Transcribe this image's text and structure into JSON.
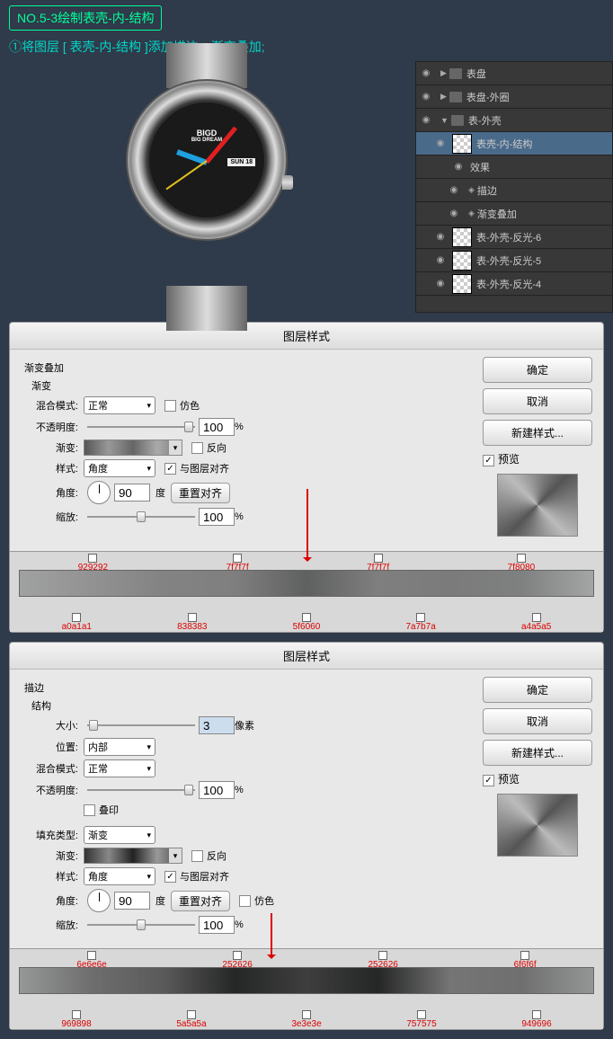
{
  "header": "NO.5-3绘制表壳-内-结构",
  "subtitle": "①将图层 [ 表壳-内-结构 ]添加描边、渐变叠加;",
  "watch": {
    "brand": "BIGD",
    "brand_sub": "BIG DREAM",
    "date": "SUN 18"
  },
  "layers": {
    "items": [
      {
        "label": "表盘",
        "type": "folder"
      },
      {
        "label": "表盘-外圈",
        "type": "folder"
      },
      {
        "label": "表-外壳",
        "type": "folder",
        "open": true
      },
      {
        "label": "表壳-内-结构",
        "type": "layer",
        "hl": true
      },
      {
        "label": "效果",
        "type": "fx"
      },
      {
        "label": "描边",
        "type": "fx"
      },
      {
        "label": "渐变叠加",
        "type": "fx"
      },
      {
        "label": "表-外壳-反光-6",
        "type": "layer"
      },
      {
        "label": "表-外壳-反光-5",
        "type": "layer"
      },
      {
        "label": "表-外壳-反光-4",
        "type": "layer"
      }
    ]
  },
  "dialog1": {
    "title": "图层样式",
    "section": "渐变叠加",
    "subsection": "渐变",
    "blend_label": "混合模式:",
    "blend_val": "正常",
    "dither_label": "仿色",
    "opacity_label": "不透明度:",
    "opacity_val": "100",
    "opacity_unit": "%",
    "gradient_label": "渐变:",
    "reverse_label": "反向",
    "style_label": "样式:",
    "style_val": "角度",
    "align_label": "与图层对齐",
    "angle_label": "角度:",
    "angle_val": "90",
    "angle_unit": "度",
    "reset_label": "重置对齐",
    "scale_label": "缩放:",
    "scale_val": "100",
    "scale_unit": "%",
    "ok": "确定",
    "cancel": "取消",
    "new_style": "新建样式...",
    "preview": "预览",
    "stops_top": [
      "929292",
      "7f7f7f",
      "7f7f7f",
      "7f8080"
    ],
    "stops_bot": [
      "a0a1a1",
      "838383",
      "5f6060",
      "7a7b7a",
      "a4a5a5"
    ]
  },
  "dialog2": {
    "title": "图层样式",
    "section": "描边",
    "subsection": "结构",
    "size_label": "大小:",
    "size_val": "3",
    "size_unit": "像素",
    "pos_label": "位置:",
    "pos_val": "内部",
    "blend_label": "混合模式:",
    "blend_val": "正常",
    "opacity_label": "不透明度:",
    "opacity_val": "100",
    "opacity_unit": "%",
    "overprint_label": "叠印",
    "fill_label": "填充类型:",
    "fill_val": "渐变",
    "gradient_label": "渐变:",
    "reverse_label": "反向",
    "style_label": "样式:",
    "style_val": "角度",
    "align_label": "与图层对齐",
    "angle_label": "角度:",
    "angle_val": "90",
    "angle_unit": "度",
    "reset_label": "重置对齐",
    "dither_label": "仿色",
    "scale_label": "缩放:",
    "scale_val": "100",
    "scale_unit": "%",
    "ok": "确定",
    "cancel": "取消",
    "new_style": "新建样式...",
    "preview": "预览",
    "stops_top": [
      "6e6e6e",
      "252626",
      "252626",
      "6f6f6f"
    ],
    "stops_bot": [
      "969898",
      "5a5a5a",
      "3e3e3e",
      "757575",
      "949696"
    ]
  }
}
